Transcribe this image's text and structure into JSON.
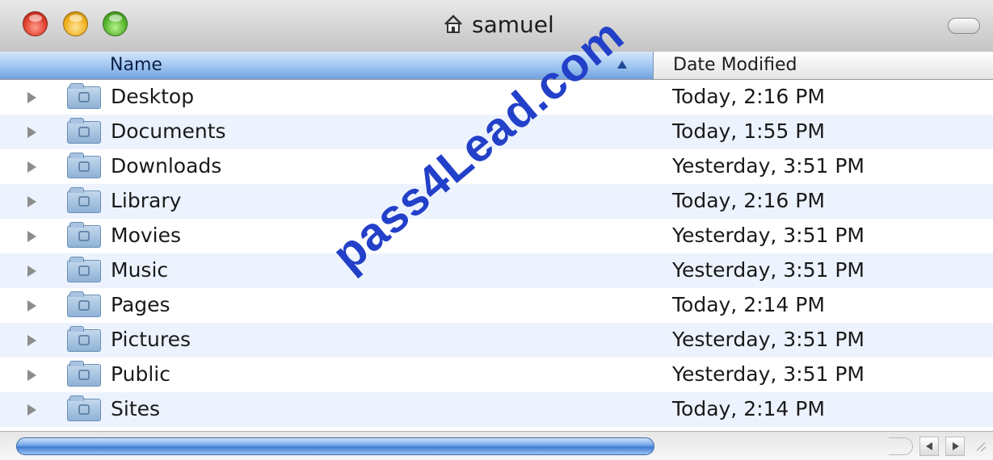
{
  "window": {
    "title": "samuel",
    "title_icon": "home-icon",
    "colors": {
      "close": "#e2412f",
      "minimize": "#f1b21f",
      "zoom": "#55b42c",
      "selection": "#9cc3ef",
      "alt_row": "#edf3fe"
    }
  },
  "columns": {
    "name": "Name",
    "date_modified": "Date Modified",
    "sort_icon": "sort-ascending-icon"
  },
  "items": [
    {
      "name": "Desktop",
      "date": "Today, 2:16 PM",
      "icon": "folder-icon"
    },
    {
      "name": "Documents",
      "date": "Today, 1:55 PM",
      "icon": "folder-icon"
    },
    {
      "name": "Downloads",
      "date": "Yesterday, 3:51 PM",
      "icon": "folder-icon"
    },
    {
      "name": "Library",
      "date": "Today, 2:16 PM",
      "icon": "folder-icon"
    },
    {
      "name": "Movies",
      "date": "Yesterday, 3:51 PM",
      "icon": "folder-icon"
    },
    {
      "name": "Music",
      "date": "Yesterday, 3:51 PM",
      "icon": "folder-icon"
    },
    {
      "name": "Pages",
      "date": "Today, 2:14 PM",
      "icon": "folder-icon"
    },
    {
      "name": "Pictures",
      "date": "Yesterday, 3:51 PM",
      "icon": "folder-icon"
    },
    {
      "name": "Public",
      "date": "Yesterday, 3:51 PM",
      "icon": "folder-icon"
    },
    {
      "name": "Sites",
      "date": "Today, 2:14 PM",
      "icon": "folder-icon"
    }
  ],
  "watermark": {
    "text": "pass4Lead.com",
    "color": "#2340c9"
  }
}
